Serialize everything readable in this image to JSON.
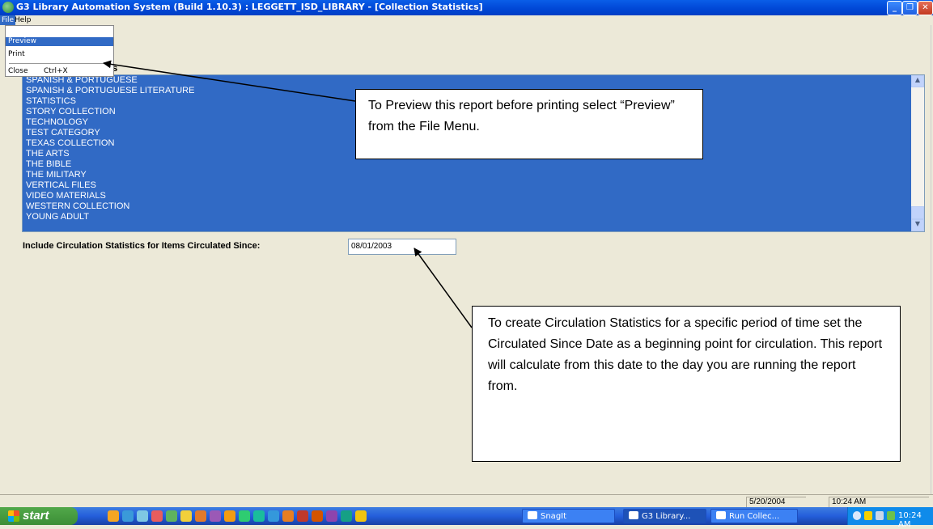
{
  "window": {
    "title": "G3 Library Automation System (Build 1.10.3) : LEGGETT_ISD_LIBRARY - [Collection Statistics]",
    "min_icon": "minimize-icon",
    "restore_icon": "restore-icon",
    "close_icon": "close-icon"
  },
  "menubar": {
    "file": "File",
    "help": "Help"
  },
  "file_menu": {
    "preview": "Preview",
    "print": "Print",
    "close": "Close",
    "close_shortcut": "Ctrl+X"
  },
  "section_header_partial": "ries",
  "categories": [
    "SPANISH & PORTUGUESE",
    "SPANISH & PORTUGUESE LITERATURE",
    "STATISTICS",
    "STORY COLLECTION",
    "TECHNOLOGY",
    "TEST CATEGORY",
    "TEXAS COLLECTION",
    "THE ARTS",
    "THE BIBLE",
    "THE MILITARY",
    "VERTICAL FILES",
    "VIDEO MATERIALS",
    "WESTERN COLLECTION",
    "YOUNG ADULT"
  ],
  "circulation": {
    "label": "Include Circulation Statistics for Items Circulated Since:",
    "since_date": "08/01/2003"
  },
  "callouts": {
    "preview_tip": "To Preview this report before printing select “Preview” from the File Menu.",
    "circulation_tip": "To create Circulation Statistics for a specific period of time set the Circulated Since Date as a beginning point for circulation. This report will calculate from this date to the day you are running the report from."
  },
  "statusbar": {
    "date": "5/20/2004",
    "time": "10:24 AM"
  },
  "taskbar": {
    "start": "start",
    "tasks": [
      "SnagIt",
      "G3 Library...",
      "Run Collec..."
    ],
    "clock": "10:24 AM"
  },
  "colors": {
    "selection": "#316ac5",
    "titlebar": "#0046d5",
    "face": "#ece9d8"
  }
}
